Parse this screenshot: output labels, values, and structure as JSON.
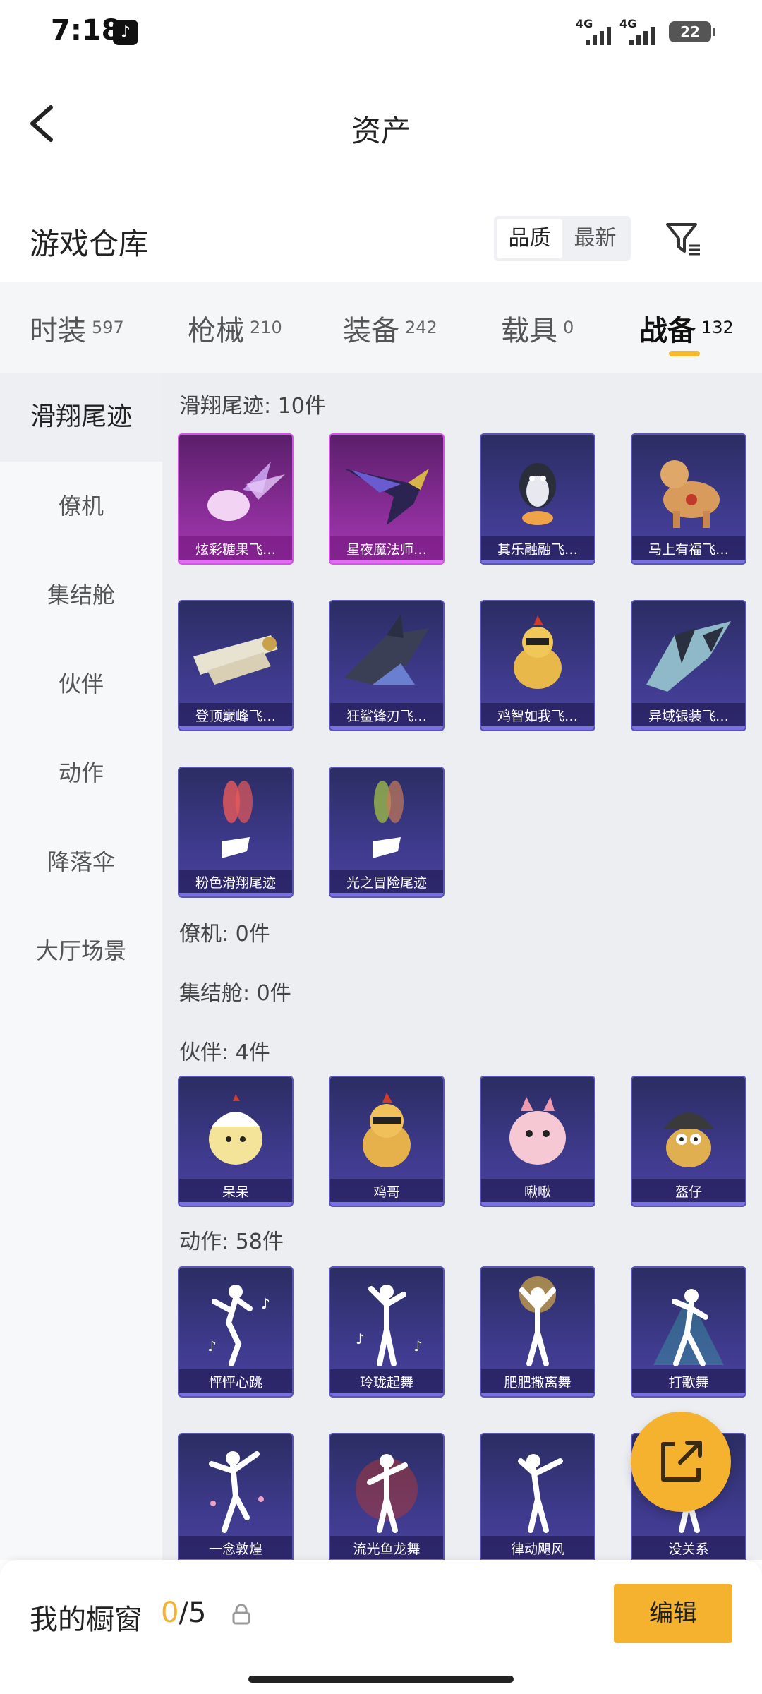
{
  "status": {
    "time": "7:18",
    "network1": "4G",
    "network2": "4G",
    "battery": "22"
  },
  "header": {
    "title": "资产"
  },
  "section": {
    "title": "游戏仓库",
    "sort_options": [
      "品质",
      "最新"
    ],
    "active_sort": "品质"
  },
  "tabs": [
    {
      "label": "时装",
      "count": "597"
    },
    {
      "label": "枪械",
      "count": "210"
    },
    {
      "label": "装备",
      "count": "242"
    },
    {
      "label": "载具",
      "count": "0"
    },
    {
      "label": "战备",
      "count": "132"
    }
  ],
  "active_tab": "战备",
  "sidebar": {
    "items": [
      "滑翔尾迹",
      "僚机",
      "集结舱",
      "伙伴",
      "动作",
      "降落伞",
      "大厅场景"
    ],
    "active": "滑翔尾迹"
  },
  "groups": {
    "glide": {
      "title": "滑翔尾迹: 10件",
      "items": [
        "炫彩糖果飞…",
        "星夜魔法师…",
        "其乐融融飞…",
        "马上有福飞…",
        "登顶巅峰飞…",
        "狂鲨锋刃飞…",
        "鸡智如我飞…",
        "异域银装飞…",
        "粉色滑翔尾迹",
        "光之冒险尾迹"
      ]
    },
    "wingman": {
      "title": "僚机: 0件"
    },
    "pod": {
      "title": "集结舱: 0件"
    },
    "partner": {
      "title": "伙伴: 4件",
      "items": [
        "呆呆",
        "鸡哥",
        "啾啾",
        "盔仔"
      ]
    },
    "emote": {
      "title": "动作: 58件",
      "items": [
        "怦怦心跳",
        "玲珑起舞",
        "肥肥撒离舞",
        "打歌舞",
        "一念敦煌",
        "流光鱼龙舞",
        "律动飓风",
        "没关系"
      ]
    }
  },
  "bottom": {
    "window_label": "我的橱窗",
    "current": "0",
    "separator": "/",
    "max": "5",
    "edit": "编辑"
  },
  "colors": {
    "accent": "#f4b22f",
    "card_blue": "#3e3a8c",
    "card_purple": "#8a2d98"
  }
}
